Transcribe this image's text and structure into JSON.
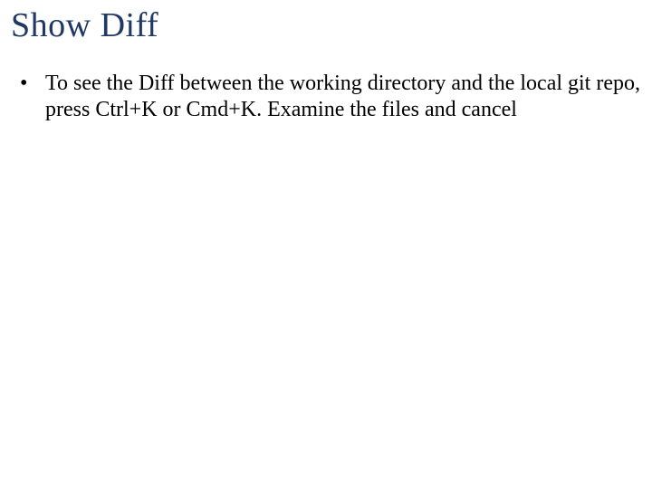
{
  "slide": {
    "title": "Show Diff",
    "bullets": [
      {
        "marker": "•",
        "text": "To see the Diff between the working directory and the local git repo, press Ctrl+K or Cmd+K. Examine the files and cancel"
      }
    ]
  }
}
